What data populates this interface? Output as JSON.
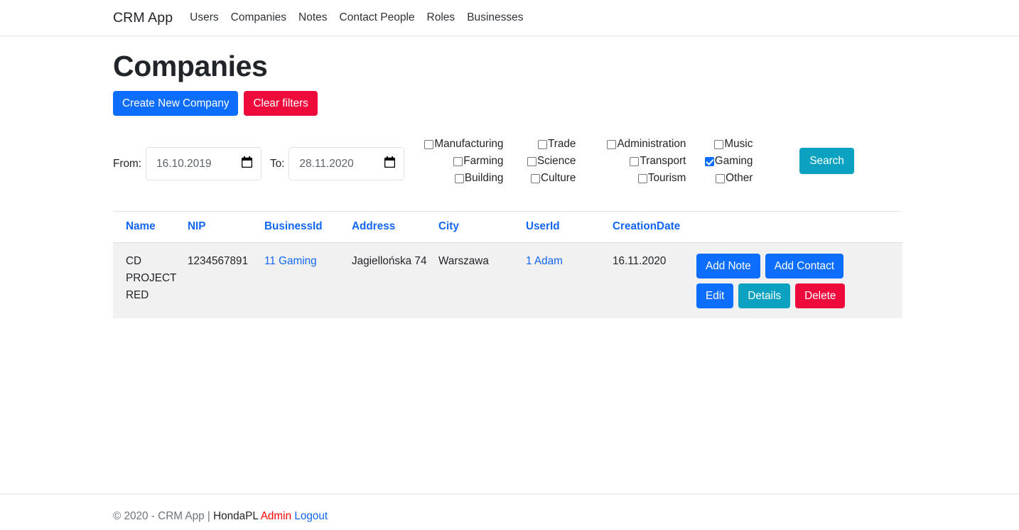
{
  "navbar": {
    "brand": "CRM App",
    "links": [
      {
        "label": "Users"
      },
      {
        "label": "Companies"
      },
      {
        "label": "Notes"
      },
      {
        "label": "Contact People"
      },
      {
        "label": "Roles"
      },
      {
        "label": "Businesses"
      }
    ]
  },
  "page": {
    "title": "Companies",
    "create_button": "Create New Company",
    "clear_button": "Clear filters"
  },
  "filters": {
    "from_label": "From:",
    "from_value": "16.10.2019",
    "to_label": "To:",
    "to_value": "28.11.2020",
    "date_icon": "calendar-icon",
    "search_button": "Search",
    "checkbox_columns": [
      [
        {
          "label": "Manufacturing",
          "checked": false
        },
        {
          "label": "Farming",
          "checked": false
        },
        {
          "label": "Building",
          "checked": false
        }
      ],
      [
        {
          "label": "Trade",
          "checked": false
        },
        {
          "label": "Science",
          "checked": false
        },
        {
          "label": "Culture",
          "checked": false
        }
      ],
      [
        {
          "label": "Administration",
          "checked": false
        },
        {
          "label": "Transport",
          "checked": false
        },
        {
          "label": "Tourism",
          "checked": false
        }
      ],
      [
        {
          "label": "Music",
          "checked": false
        },
        {
          "label": "Gaming",
          "checked": true
        },
        {
          "label": "Other",
          "checked": false
        }
      ]
    ]
  },
  "table": {
    "headers": [
      {
        "label": "Name"
      },
      {
        "label": "NIP"
      },
      {
        "label": "BusinessId"
      },
      {
        "label": "Address"
      },
      {
        "label": "City"
      },
      {
        "label": "UserId"
      },
      {
        "label": "CreationDate"
      }
    ],
    "rows": [
      {
        "name": "CD PROJECT RED",
        "nip": "1234567891",
        "business_id": "11 Gaming",
        "address": "Jagiellońska 74",
        "city": "Warszawa",
        "user_id": "1 Adam",
        "creation_date": "16.11.2020",
        "actions": {
          "add_note": "Add Note",
          "add_contact": "Add Contact",
          "edit": "Edit",
          "details": "Details",
          "delete": "Delete"
        }
      }
    ]
  },
  "footer": {
    "copyright": "© 2020 - CRM App |",
    "user": "HondaPL",
    "admin": "Admin",
    "logout": "Logout"
  },
  "colors": {
    "primary": "#0d6efd",
    "danger": "#ef0a3c",
    "info": "#0aa2c0",
    "link": "#1266f1",
    "row_bg": "#f1f1f1",
    "admin_red": "#ff0000"
  }
}
